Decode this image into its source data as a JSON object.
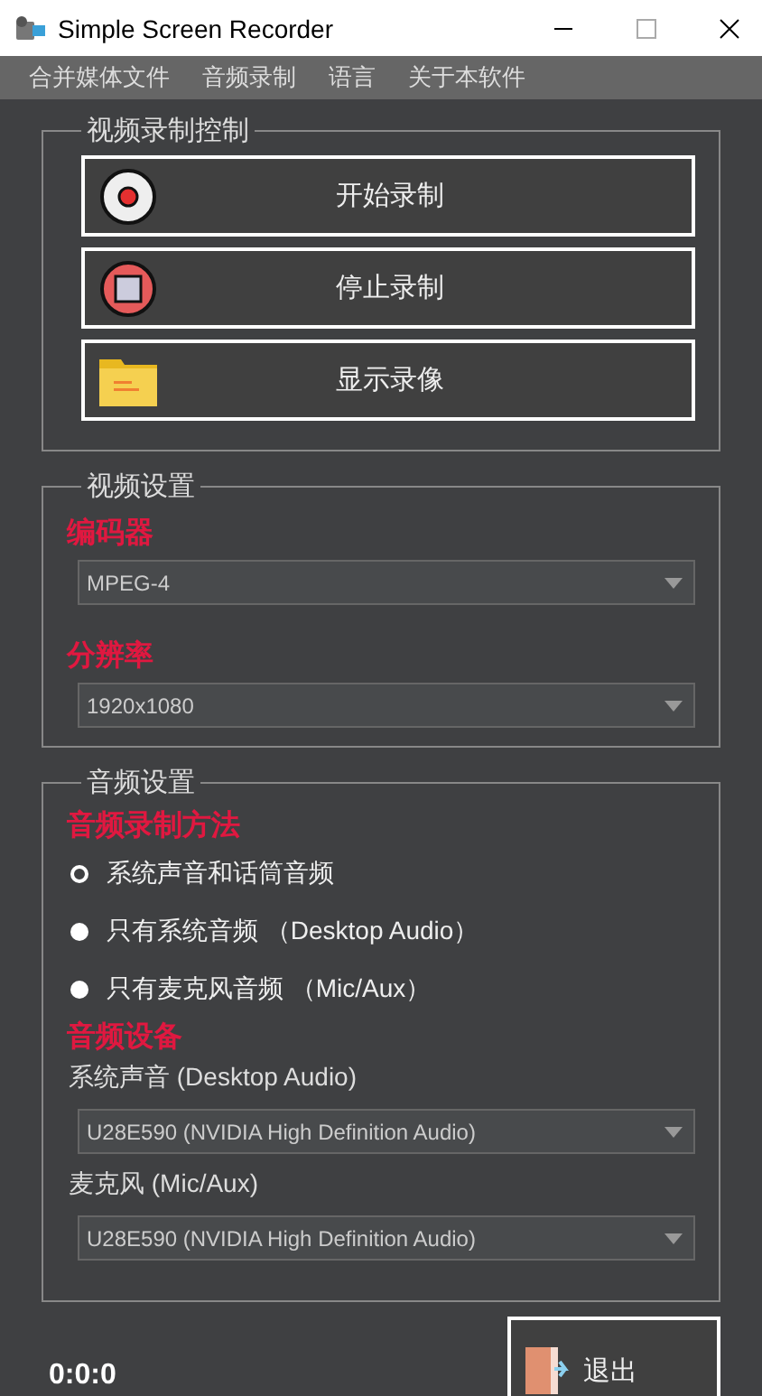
{
  "window": {
    "title": "Simple Screen Recorder"
  },
  "menu": [
    "合并媒体文件",
    "音频录制",
    "语言",
    "关于本软件"
  ],
  "record_control": {
    "title": "视频录制控制",
    "buttons": [
      {
        "label": "开始录制",
        "kind": "record"
      },
      {
        "label": "停止录制",
        "kind": "stop"
      },
      {
        "label": "显示录像",
        "kind": "folder"
      }
    ]
  },
  "video_settings": {
    "title": "视频设置",
    "fields": [
      {
        "label": "编码器",
        "value": "MPEG-4"
      },
      {
        "label": "分辨率",
        "value": "1920x1080"
      }
    ]
  },
  "audio_settings": {
    "title": "音频设置",
    "method_label": "音频录制方法",
    "options": [
      {
        "label": "系统声音和话筒音频",
        "selected": true
      },
      {
        "label": "只有系统音频 （Desktop Audio）",
        "selected": false
      },
      {
        "label": "只有麦克风音频 （Mic/Aux）",
        "selected": false
      }
    ],
    "devices_label": "音频设备",
    "devices": [
      {
        "label": "系统声音 (Desktop Audio)",
        "value": "U28E590 (NVIDIA High Definition Audio)"
      },
      {
        "label": "麦克风 (Mic/Aux)",
        "value": "U28E590 (NVIDIA High Definition Audio)"
      }
    ]
  },
  "timer": "0:0:0",
  "exit_button": "退出"
}
